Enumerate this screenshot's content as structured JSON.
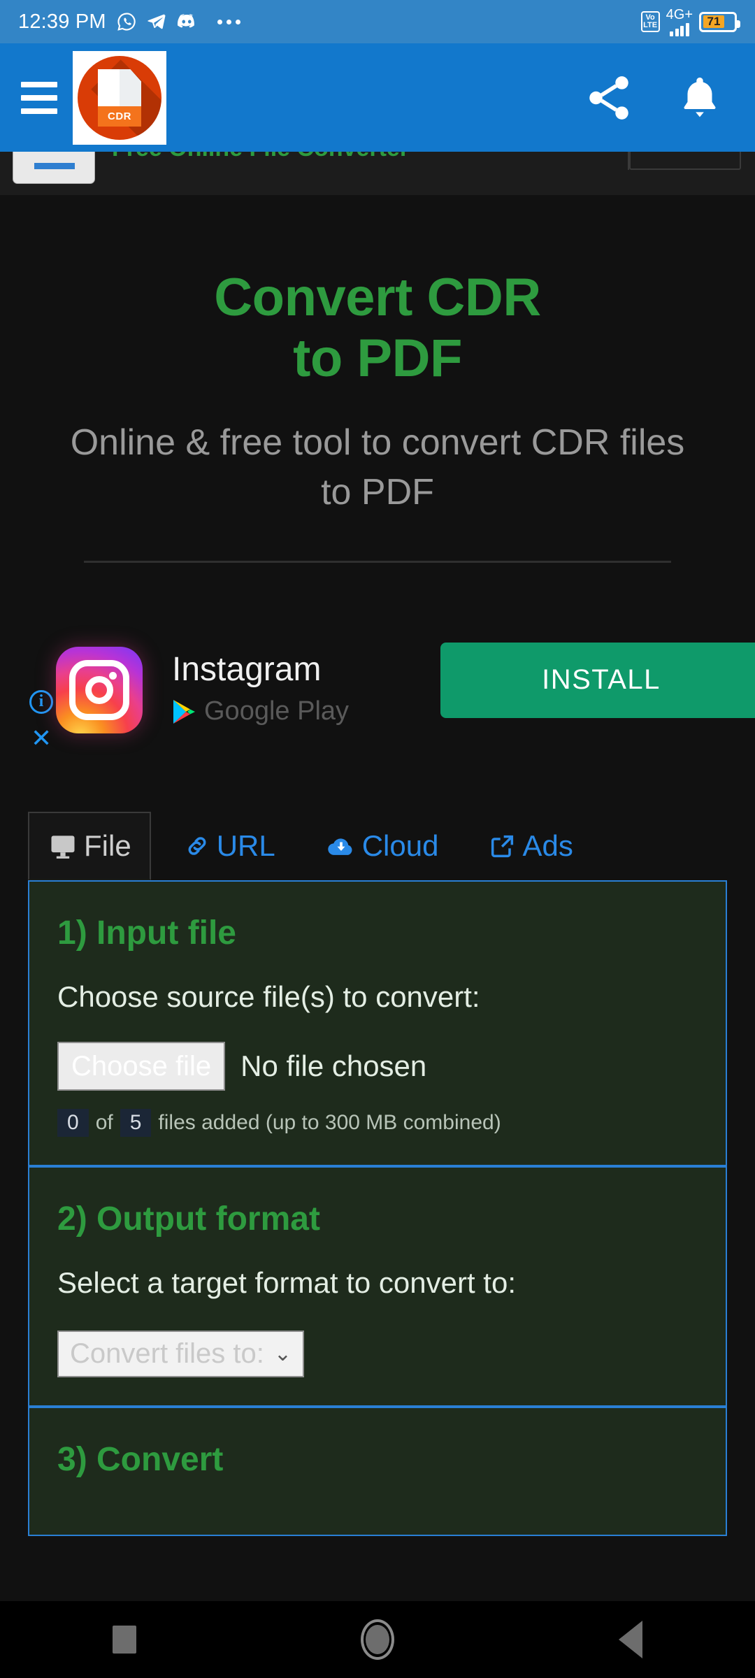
{
  "status_bar": {
    "time": "12:39 PM",
    "icons": [
      "whatsapp-icon",
      "telegram-icon",
      "discord-icon",
      "overflow-dots"
    ],
    "volte_label_top": "Vo",
    "volte_label_bottom": "LTE",
    "network": "4G+",
    "battery_percent": "71"
  },
  "app_bar": {
    "menu": "menu-icon",
    "logo_label": "CDR",
    "share": "share-icon",
    "notifications": "bell-icon",
    "background_color": "#1278cc"
  },
  "page_strip": {
    "site_title": "Free Online File Converter"
  },
  "hero": {
    "title_line1": "Convert CDR",
    "title_line2": "to PDF",
    "subtitle": "Online & free tool to convert CDR files to PDF",
    "title_color": "#2e9b3f"
  },
  "ad": {
    "app_name": "Instagram",
    "store": "Google Play",
    "cta": "INSTALL",
    "cta_color": "#0f9a6a",
    "info_glyph": "i",
    "close_glyph": "✕"
  },
  "tabs": [
    {
      "label": "File",
      "icon": "monitor-icon",
      "active": true
    },
    {
      "label": "URL",
      "icon": "link-icon",
      "active": false
    },
    {
      "label": "Cloud",
      "icon": "cloud-download-icon",
      "active": false
    },
    {
      "label": "Ads",
      "icon": "external-link-icon",
      "active": false
    }
  ],
  "form": {
    "step1": {
      "heading": "1) Input file",
      "label": "Choose source file(s) to convert:",
      "button": "Choose file",
      "file_status": "No file chosen",
      "count_current": "0",
      "count_of": "of",
      "count_max": "5",
      "count_suffix": "files added (up to 300 MB combined)"
    },
    "step2": {
      "heading": "2) Output format",
      "label": "Select a target format to convert to:",
      "select_value": "Convert files to:",
      "chevron": "⌄"
    },
    "step3": {
      "heading": "3) Convert"
    }
  },
  "nav_bar": {
    "recents": "recents-icon",
    "home": "home-icon",
    "back": "back-icon"
  }
}
